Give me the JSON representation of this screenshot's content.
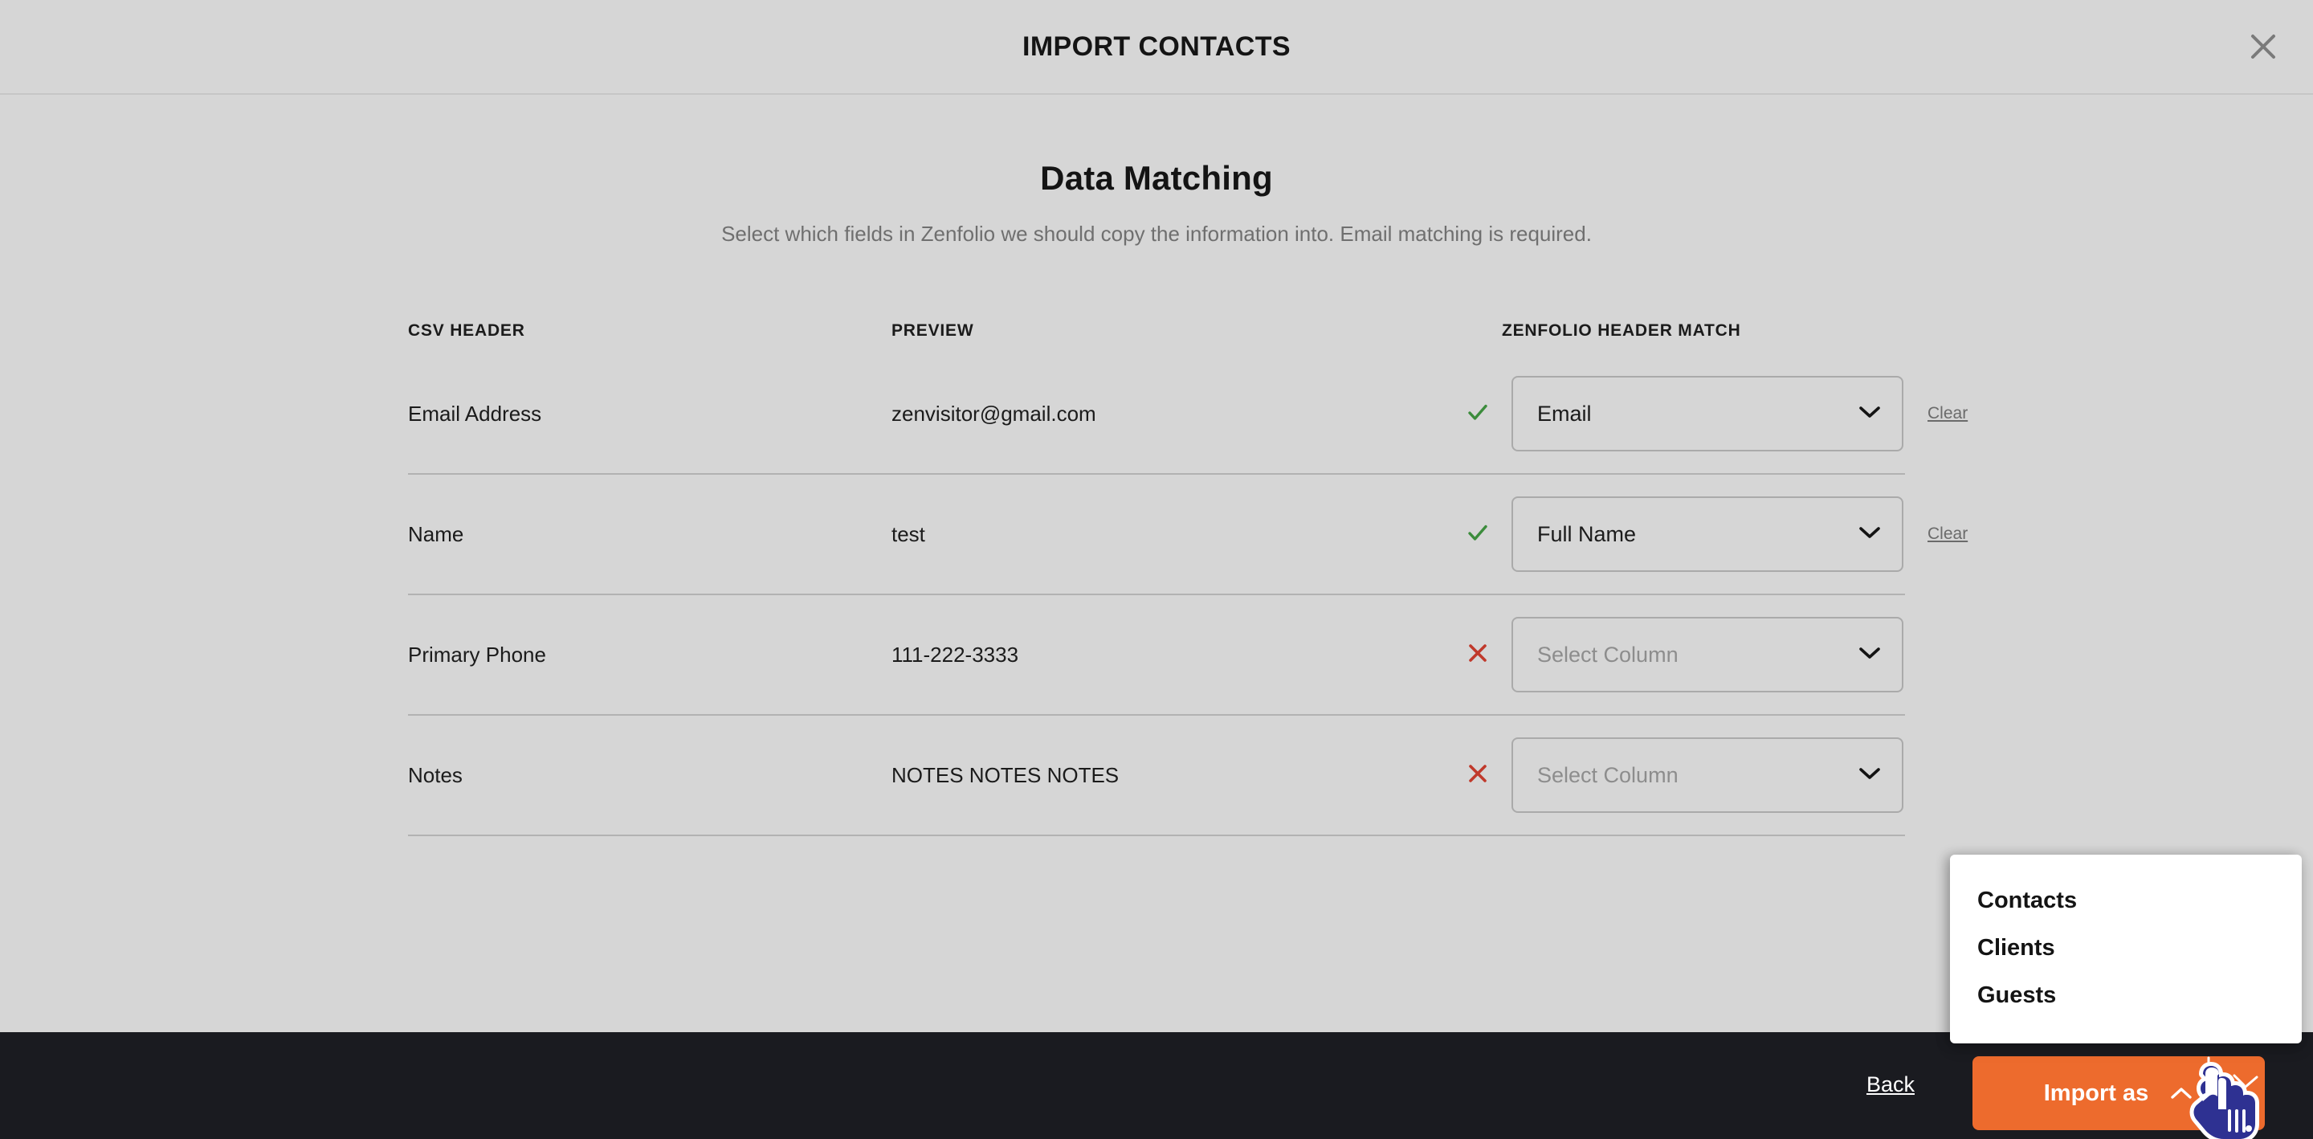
{
  "modal": {
    "title": "IMPORT CONTACTS",
    "close_icon": "close-icon"
  },
  "content": {
    "heading": "Data Matching",
    "subheading": "Select which fields in Zenfolio we should copy the information into. Email matching is required."
  },
  "table": {
    "columns": {
      "csv_header": "CSV HEADER",
      "preview": "PREVIEW",
      "zenfolio_header_match": "ZENFOLIO HEADER MATCH"
    },
    "rows": [
      {
        "csv_header": "Email Address",
        "preview": "zenvisitor@gmail.com",
        "status": "matched",
        "status_icon": "check-icon",
        "select_value": "Email",
        "is_placeholder": false,
        "clear_label": "Clear",
        "has_clear": true
      },
      {
        "csv_header": "Name",
        "preview": "test",
        "status": "matched",
        "status_icon": "check-icon",
        "select_value": "Full Name",
        "is_placeholder": false,
        "clear_label": "Clear",
        "has_clear": true
      },
      {
        "csv_header": "Primary Phone",
        "preview": "111-222-3333",
        "status": "unmatched",
        "status_icon": "x-icon",
        "select_value": "Select Column",
        "is_placeholder": true,
        "clear_label": "",
        "has_clear": false
      },
      {
        "csv_header": "Notes",
        "preview": "NOTES NOTES NOTES",
        "status": "unmatched",
        "status_icon": "x-icon",
        "select_value": "Select Column",
        "is_placeholder": true,
        "clear_label": "",
        "has_clear": false
      }
    ]
  },
  "import_menu": {
    "items": [
      {
        "label": "Contacts"
      },
      {
        "label": "Clients"
      },
      {
        "label": "Guests"
      }
    ]
  },
  "footer": {
    "back_label": "Back",
    "import_label": "Import as"
  },
  "colors": {
    "background": "#d6d6d6",
    "footer": "#1a1b20",
    "accent": "#ed6b2d",
    "match_ok": "#3c8c3c",
    "match_error": "#c0392b",
    "menu_background": "#ffffff",
    "cursor_fill": "#2e3192"
  }
}
